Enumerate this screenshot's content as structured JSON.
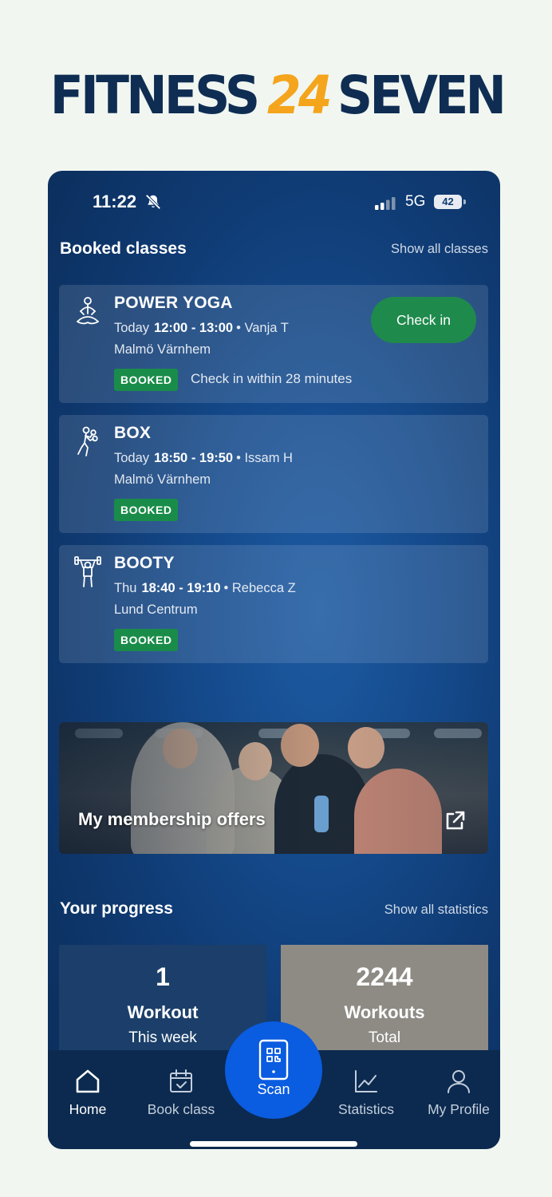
{
  "brand": {
    "part1": "FITNESS",
    "part2": "24",
    "part3": "SEVEN"
  },
  "status_bar": {
    "time": "11:22",
    "network": "5G",
    "battery": "42"
  },
  "booked": {
    "title": "Booked classes",
    "link": "Show all classes",
    "classes": [
      {
        "icon": "yoga-pose-icon",
        "name": "POWER YOGA",
        "day": "Today",
        "time": "12:00 - 13:00",
        "instructor": "• Vanja T",
        "location": "Malmö Värnhem",
        "badge": "BOOKED",
        "note": "Check in within 28 minutes",
        "action": "Check in"
      },
      {
        "icon": "boxing-person-icon",
        "name": "BOX",
        "day": "Today",
        "time": "18:50 - 19:50",
        "instructor": "• Issam H",
        "location": "Malmö Värnhem",
        "badge": "BOOKED"
      },
      {
        "icon": "weightlifter-icon",
        "name": "BOOTY",
        "day": "Thu",
        "time": "18:40 - 19:10",
        "instructor": "• Rebecca Z",
        "location": "Lund Centrum",
        "badge": "BOOKED"
      }
    ]
  },
  "offer": {
    "title": "My membership offers",
    "icon": "external-link-icon"
  },
  "progress": {
    "title": "Your progress",
    "link": "Show all statistics",
    "cards": [
      {
        "value": "1",
        "label": "Workout",
        "sub": "This week",
        "color": "#1b3f6a"
      },
      {
        "value": "2244",
        "label": "Workouts",
        "sub": "Total",
        "color": "#8e8b85"
      }
    ]
  },
  "tabbar": {
    "home": "Home",
    "book": "Book class",
    "scan": "Scan",
    "statistics": "Statistics",
    "profile": "My Profile"
  },
  "colors": {
    "brand_dark": "#0f2d52",
    "brand_accent": "#f4a51c",
    "booked_green": "#1a8c4a",
    "scan_blue": "#0a5ce0"
  }
}
